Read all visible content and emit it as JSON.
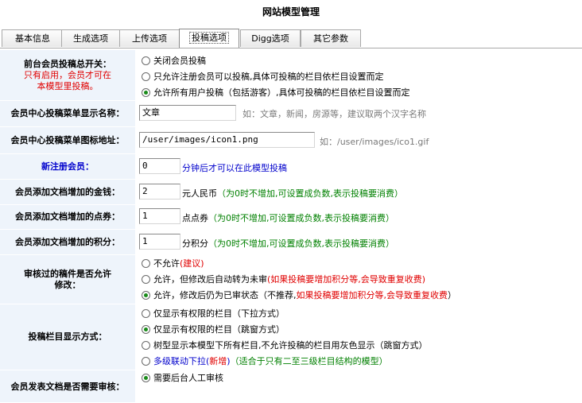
{
  "title": "网站模型管理",
  "tabs": [
    {
      "label": "基本信息",
      "active": false
    },
    {
      "label": "生成选项",
      "active": false
    },
    {
      "label": "上传选项",
      "active": false
    },
    {
      "label": "投稿选项",
      "active": true
    },
    {
      "label": "Digg选项",
      "active": false
    },
    {
      "label": "其它参数",
      "active": false
    }
  ],
  "rows": {
    "switch": {
      "label": "前台会员投稿总开关：",
      "note": "只有启用，会员才可在本模型里投稿。",
      "options": [
        "关闭会员投稿",
        "只允许注册会员可以投稿,具体可投稿的栏目依栏目设置而定",
        "允许所有用户投稿（包括游客）,具体可投稿的栏目依栏目设置而定"
      ],
      "selected_index": 2
    },
    "menu_name": {
      "label": "会员中心投稿菜单显示名称：",
      "value": "文章",
      "hint": "如：文章，新闻，房源等，建议取两个汉字名称"
    },
    "menu_icon": {
      "label": "会员中心投稿菜单图标地址：",
      "value": "/user/images/icon1.png",
      "hint": "如：/user/images/ico1.gif"
    },
    "new_member": {
      "label": "新注册会员：",
      "value": "0",
      "suffix": "分钟后才可以在此模型投稿"
    },
    "money": {
      "label": "会员添加文档增加的金钱：",
      "value": "2",
      "unit": "元人民币",
      "note": "（为0时不增加,可设置成负数,表示投稿要消费）"
    },
    "points": {
      "label": "会员添加文档增加的点券：",
      "value": "1",
      "unit": "点点券",
      "note": "（为0时不增加,可设置成负数,表示投稿要消费）"
    },
    "score": {
      "label": "会员添加文档增加的积分：",
      "value": "1",
      "unit": "分积分",
      "note": "（为0时不增加,可设置成负数,表示投稿要消费）"
    },
    "edit": {
      "label": "审核过的稿件是否允许修改：",
      "opt0": "不允许",
      "opt0_red": "(建议)",
      "opt1": "允许，但修改后自动转为未审",
      "opt1_red": "(如果投稿要增加积分等,会导致重复收费)",
      "opt2": "允许，修改后仍为已审状态（不推荐,",
      "opt2_red": "如果投稿要增加积分等,会导致重复收费",
      "opt2_tail": "）",
      "selected_index": 2
    },
    "display": {
      "label": "投稿栏目显示方式：",
      "opt0": "仅显示有权限的栏目（下拉方式）",
      "opt1": "仅显示有权限的栏目（跳窗方式）",
      "opt2": "树型显示本模型下所有栏目,不允许投稿的栏目用灰色显示（跳窗方式）",
      "opt3": "多级联动下拉(",
      "opt3_red": "新增",
      "opt3_mid": ")",
      "opt3_green": "（适合于只有二至三级栏目结构的模型）",
      "selected_index": 1
    },
    "audit": {
      "label": "会员发表文档是否需要审核：",
      "opt0": "需要后台人工审核",
      "selected_index": 0
    }
  }
}
